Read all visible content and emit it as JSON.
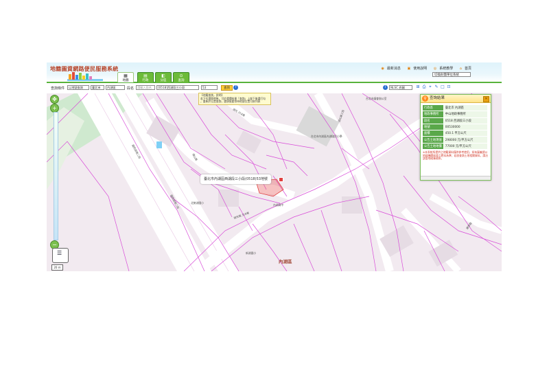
{
  "header": {
    "system_title": "地籍圖資網路便民服務系統",
    "tabs": [
      {
        "label": "地圖",
        "icon": "map-icon"
      },
      {
        "label": "行政",
        "icon": "building-icon"
      },
      {
        "label": "分區",
        "icon": "zone-icon"
      },
      {
        "label": "查詢",
        "icon": "search-icon"
      }
    ],
    "links": [
      {
        "label": "最新消息",
        "icon": "news-icon"
      },
      {
        "label": "使用說明",
        "icon": "book-icon"
      },
      {
        "label": "系統教學",
        "icon": "teach-icon"
      },
      {
        "label": "首頁",
        "icon": "home-icon"
      }
    ],
    "agency_select": "切換財團單位系統"
  },
  "query": {
    "label_condition": "查詢條件",
    "condition_select": "以地號查詢",
    "city_select": "臺北市",
    "district_select": "內湖區",
    "section_label": "段名",
    "section_input_placeholder": "請輸入段名",
    "section_select": "[0518]西湖段三小段",
    "lot_number": "53",
    "search_button": "查詢",
    "coord_select": "NLSC 底圖"
  },
  "tooltip": {
    "line1": "【地籍查詢，說明】",
    "line2": "若下拉選單時無，可於選擇結果「查詢」上按下後選打勾",
    "line3": "，重新於位置查詢，選項需要等待地號位置可按列表"
  },
  "map": {
    "district_label": "內湖區",
    "marker_text": "臺北市內湖區西湖段三小段(0518)53地號",
    "poi": [
      "台北市內湖區內湖國民小學",
      "台北市議會辦公室",
      "北勢湖國小",
      "內湖高中",
      "新湖國小",
      "國賓飯店",
      "西湖路",
      "湖光路",
      "成功路三段"
    ],
    "road_labels": [
      "國防部路二段",
      "國防部路二段",
      "湖光路三段",
      "環山路",
      "康寧路",
      "湖光路 318巷",
      "湖光 318巷"
    ],
    "scale": "20 m"
  },
  "result": {
    "title": "查詢結果",
    "rows": [
      {
        "key": "行政區",
        "value": "臺北市 內湖區"
      },
      {
        "key": "地政事務所",
        "value": "中山地政事務所"
      },
      {
        "key": "段名",
        "value": "0518 西湖段三小段"
      },
      {
        "key": "地號",
        "value": "00530000"
      },
      {
        "key": "面積",
        "value": "450.1 平方公尺"
      },
      {
        "key": "公告土地現值",
        "value": "298000 元/平方公尺"
      },
      {
        "key": "公告土地地價",
        "value": "77000 元/平方公尺"
      }
    ],
    "note": "※本系統所提供之地籍資料僅供參考使用，如有疑義請以地政機關核發之謄本為準；若欲查詢土地相關資料，請洽該管地政事務所。"
  },
  "colors": {
    "accent_green": "#58b33a",
    "parcel_line": "#d84bd8",
    "map_bg": "#f2eaf0",
    "road": "#ffffff"
  }
}
